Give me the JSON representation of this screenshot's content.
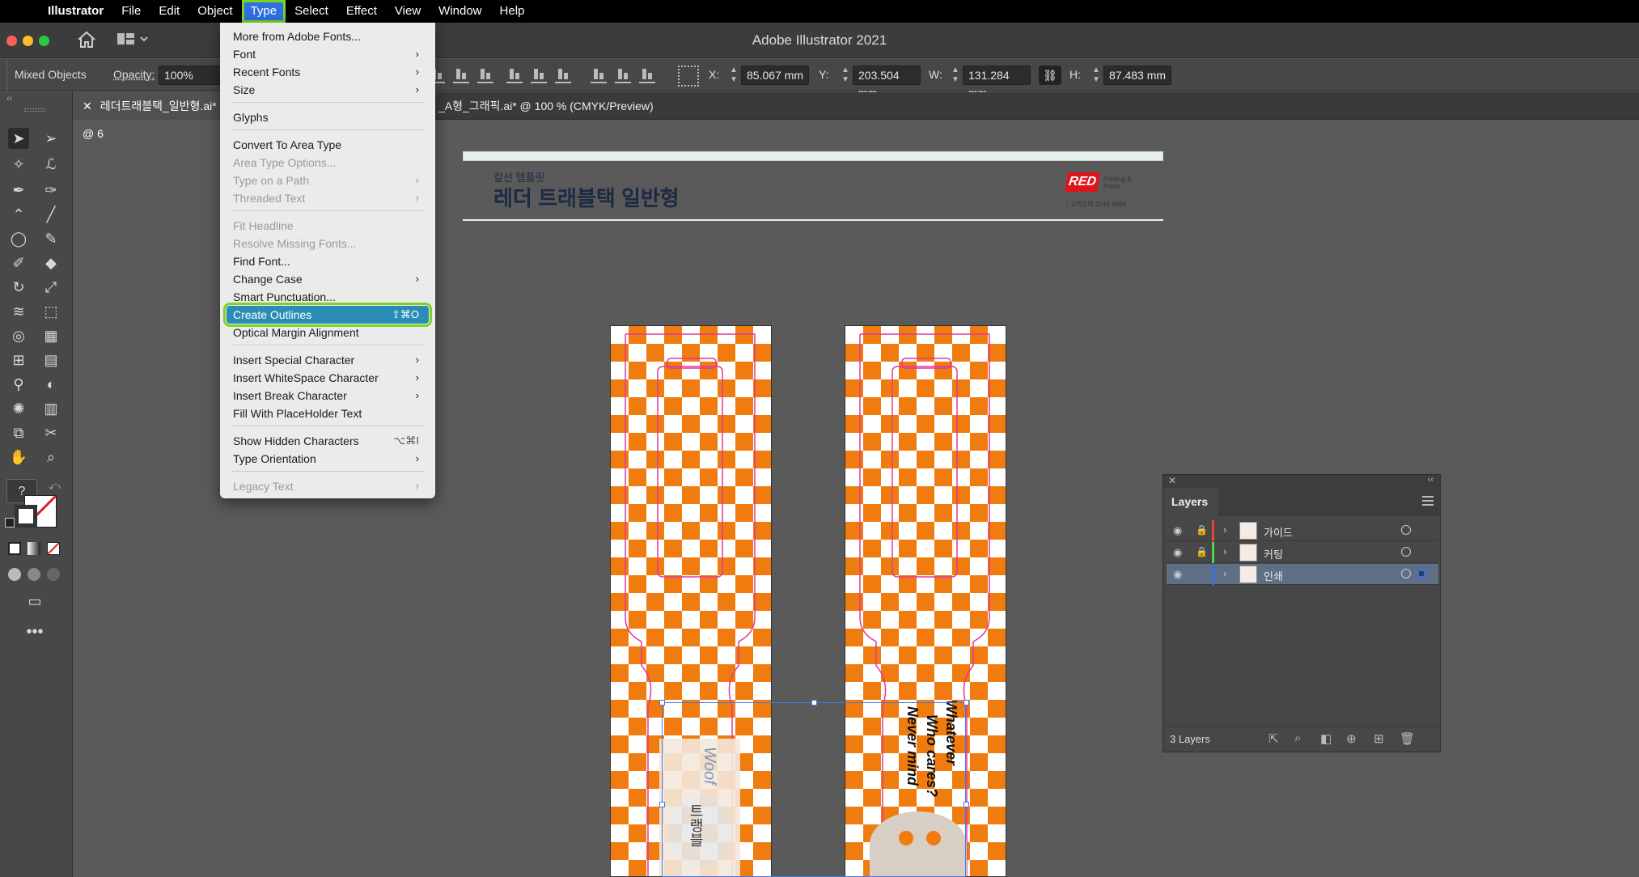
{
  "menubar": {
    "app": "Illustrator",
    "items": [
      "File",
      "Edit",
      "Object",
      "Type",
      "Select",
      "Effect",
      "View",
      "Window",
      "Help"
    ]
  },
  "window": {
    "title": "Adobe Illustrator 2021"
  },
  "controlbar": {
    "selection": "Mixed Objects",
    "opacity_label": "Opacity:",
    "opacity_value": "100%",
    "x_label": "X:",
    "x_value": "85.067 mm",
    "y_label": "Y:",
    "y_value": "203.504 mm",
    "w_label": "W:",
    "w_value": "131.284 mm",
    "h_label": "H:",
    "h_value": "87.483 mm"
  },
  "tabs": [
    {
      "label": "레더트래블택_일반형.ai* @ 6"
    },
    {
      "label": "_A형_그래픽.ai* @ 100 % (CMYK/Preview)"
    }
  ],
  "type_menu": {
    "items": [
      {
        "label": "More from Adobe Fonts...",
        "enabled": true,
        "submenu": false,
        "shortcut": ""
      },
      {
        "label": "Font",
        "enabled": true,
        "submenu": true,
        "shortcut": ""
      },
      {
        "label": "Recent Fonts",
        "enabled": true,
        "submenu": true,
        "shortcut": ""
      },
      {
        "label": "Size",
        "enabled": true,
        "submenu": true,
        "shortcut": ""
      },
      {
        "label": "Glyphs",
        "enabled": true,
        "submenu": false,
        "shortcut": ""
      },
      {
        "label": "Convert To Area Type",
        "enabled": true,
        "submenu": false,
        "shortcut": ""
      },
      {
        "label": "Area Type Options...",
        "enabled": false,
        "submenu": false,
        "shortcut": ""
      },
      {
        "label": "Type on a Path",
        "enabled": false,
        "submenu": true,
        "shortcut": ""
      },
      {
        "label": "Threaded Text",
        "enabled": false,
        "submenu": true,
        "shortcut": ""
      },
      {
        "label": "Fit Headline",
        "enabled": false,
        "submenu": false,
        "shortcut": ""
      },
      {
        "label": "Resolve Missing Fonts...",
        "enabled": false,
        "submenu": false,
        "shortcut": ""
      },
      {
        "label": "Find Font...",
        "enabled": true,
        "submenu": false,
        "shortcut": ""
      },
      {
        "label": "Change Case",
        "enabled": true,
        "submenu": true,
        "shortcut": ""
      },
      {
        "label": "Smart Punctuation...",
        "enabled": true,
        "submenu": false,
        "shortcut": ""
      },
      {
        "label": "Create Outlines",
        "enabled": true,
        "submenu": false,
        "shortcut": "⇧⌘O",
        "highlighted": true
      },
      {
        "label": "Optical Margin Alignment",
        "enabled": true,
        "submenu": false,
        "shortcut": ""
      },
      {
        "label": "Insert Special Character",
        "enabled": true,
        "submenu": true,
        "shortcut": ""
      },
      {
        "label": "Insert WhiteSpace Character",
        "enabled": true,
        "submenu": true,
        "shortcut": ""
      },
      {
        "label": "Insert Break Character",
        "enabled": true,
        "submenu": true,
        "shortcut": ""
      },
      {
        "label": "Fill With PlaceHolder Text",
        "enabled": true,
        "submenu": false,
        "shortcut": ""
      },
      {
        "label": "Show Hidden Characters",
        "enabled": true,
        "submenu": false,
        "shortcut": "⌥⌘I"
      },
      {
        "label": "Type Orientation",
        "enabled": true,
        "submenu": true,
        "shortcut": ""
      },
      {
        "label": "Legacy Text",
        "enabled": false,
        "submenu": true,
        "shortcut": ""
      }
    ]
  },
  "artboard": {
    "subtitle": "칼선 템플릿",
    "title": "레더 트래블택 일반형",
    "logo_text": "RED",
    "logo_tag": "Printing & Press",
    "contact": "| 고객문의  1544-6698"
  },
  "strip_text": {
    "left_word": "Woof",
    "left_korean": "트랭블",
    "right_lines": [
      "Whatever",
      "Who cares?",
      "Never mind"
    ]
  },
  "layers": {
    "title": "Layers",
    "count": "3 Layers",
    "rows": [
      {
        "name": "가이드",
        "color": "#e8423a",
        "locked": true,
        "selected": false
      },
      {
        "name": "커팅",
        "color": "#4fd34a",
        "locked": true,
        "selected": false
      },
      {
        "name": "인쇄",
        "color": "#3b6de0",
        "locked": false,
        "selected": true
      }
    ]
  },
  "colors": {
    "highlight": "#7ed321",
    "menu_selection": "#2a8db5",
    "checker": "#f07c0f"
  }
}
